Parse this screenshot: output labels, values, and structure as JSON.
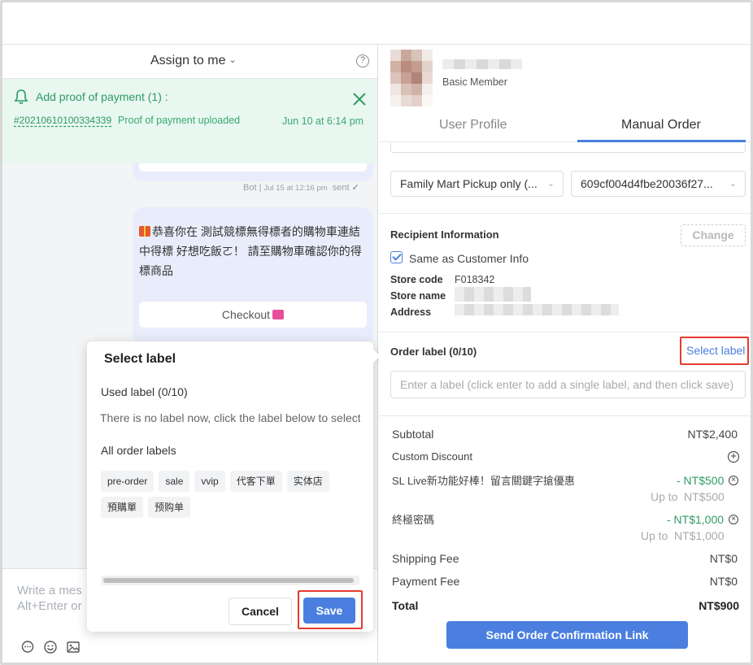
{
  "chat_header": {
    "assign_label": "Assign to me",
    "help_glyph": "?"
  },
  "proof_banner": {
    "title": "Add proof of payment (1) :",
    "order_id": "#20210610100334339",
    "status": "Proof of payment uploaded",
    "time": "Jun 10 at 6:14 pm"
  },
  "message_meta": {
    "sender": "Bot",
    "timestamp": "Jul 15 at 12:16 pm",
    "status": "sent"
  },
  "message": {
    "text": "恭喜你在 測試競標無得標者的購物車連結 中得標 好想吃飯ㄛ！ 請至購物車確認你的得標商品",
    "checkout_label": "Checkout"
  },
  "composer": {
    "placeholder_line1": "Write a mes",
    "placeholder_line2": "Alt+Enter or"
  },
  "label_popover": {
    "title": "Select label",
    "used_label": "Used label (0/10)",
    "empty_text": "There is no label now, click the label below to select",
    "all_labels_title": "All order labels",
    "tags": [
      "pre-order",
      "sale",
      "vvip",
      "代客下單",
      "实体店",
      "預購單",
      "预购单"
    ],
    "cancel_label": "Cancel",
    "save_label": "Save"
  },
  "profile": {
    "member_level": "Basic Member"
  },
  "tabs": [
    "User Profile",
    "Manual Order"
  ],
  "order": {
    "delivery_method": "Family Mart Pickup only (...",
    "delivery_option": "609cf004d4fbe20036f27...",
    "recipient_title": "Recipient Information",
    "change_label": "Change",
    "same_as_customer": "Same as Customer Info",
    "store_code_label": "Store code",
    "store_code": "F018342",
    "store_name_label": "Store name",
    "address_label": "Address",
    "order_label_title": "Order label (0/10)",
    "select_label_link": "Select label",
    "label_input_placeholder": "Enter a label (click enter to add a single label, and then click save)"
  },
  "summary": {
    "subtotal_label": "Subtotal",
    "subtotal": "NT$2,400",
    "custom_discount_label": "Custom Discount",
    "promo1_name": "SL Live新功能好棒！留言關鍵字搶優惠",
    "promo1_value": "- NT$500",
    "promo1_upto_label": "Up to",
    "promo1_upto": "NT$500",
    "promo2_name": "終極密碼",
    "promo2_value": "- NT$1,000",
    "promo2_upto_label": "Up to",
    "promo2_upto": "NT$1,000",
    "shipping_label": "Shipping Fee",
    "shipping": "NT$0",
    "payment_label": "Payment Fee",
    "payment": "NT$0",
    "total_label": "Total",
    "total": "NT$900",
    "send_button": "Send Order Confirmation Link"
  },
  "colors": {
    "accent": "#4a7fe0",
    "success": "#2f9a67",
    "highlight": "#e63a2e"
  }
}
